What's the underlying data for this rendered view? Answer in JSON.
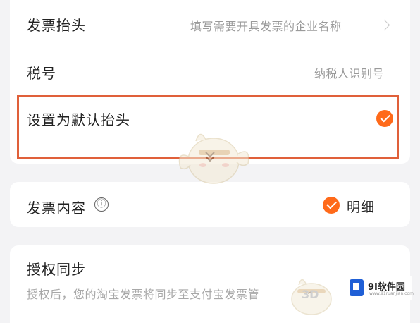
{
  "invoice": {
    "title_label": "发票抬头",
    "title_placeholder": "填写需要开具发票的企业名称",
    "tax_label": "税号",
    "tax_placeholder": "纳税人识别号",
    "default_label": "设置为默认抬头",
    "default_checked": true
  },
  "content": {
    "label": "发票内容",
    "info_icon": "ⓘ",
    "option_label": "明细",
    "option_checked": true
  },
  "sync": {
    "label": "授权同步",
    "description": "授权后，您的淘宝发票将同步至支付宝发票管"
  },
  "watermark": {
    "brand": "9I软件园",
    "sub": "www.91ruanjian.com",
    "overlay": "3D"
  },
  "colors": {
    "accent": "#ff6a1a",
    "highlight_border": "#e0603a",
    "background": "#f3f3f5"
  },
  "icons": [
    "chevron-right-icon",
    "checkmark-icon",
    "info-icon",
    "mascot-icon",
    "site-logo-icon"
  ]
}
